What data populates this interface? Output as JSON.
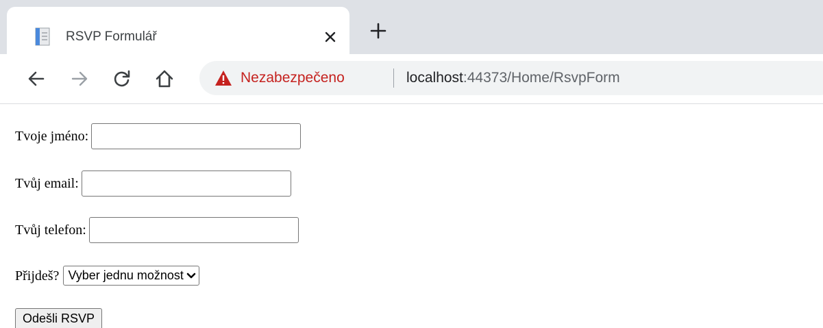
{
  "browser": {
    "tab": {
      "title": "RSVP Formulář",
      "icon": "page-icon",
      "close_icon": "close-icon"
    },
    "new_tab_icon": "plus-icon",
    "nav": {
      "back_icon": "arrow-left-icon",
      "forward_icon": "arrow-right-icon",
      "reload_icon": "reload-icon",
      "home_icon": "home-icon"
    },
    "omnibox": {
      "security_icon": "warning-triangle-icon",
      "security_label": "Nezabezpečeno",
      "url_host": "localhost",
      "url_path": ":44373/Home/RsvpForm"
    }
  },
  "form": {
    "name_label": "Tvoje jméno:",
    "name_value": "",
    "email_label": "Tvůj email:",
    "email_value": "",
    "phone_label": "Tvůj telefon:",
    "phone_value": "",
    "attend_label": "Přijdeš?",
    "attend_selected": "Vyber jednu možnost",
    "submit_label": "Odešli RSVP"
  },
  "colors": {
    "tabstrip_bg": "#dee1e6",
    "omnibox_bg": "#f1f3f4",
    "insecure_red": "#c5221f",
    "button_bg": "#efefef"
  }
}
